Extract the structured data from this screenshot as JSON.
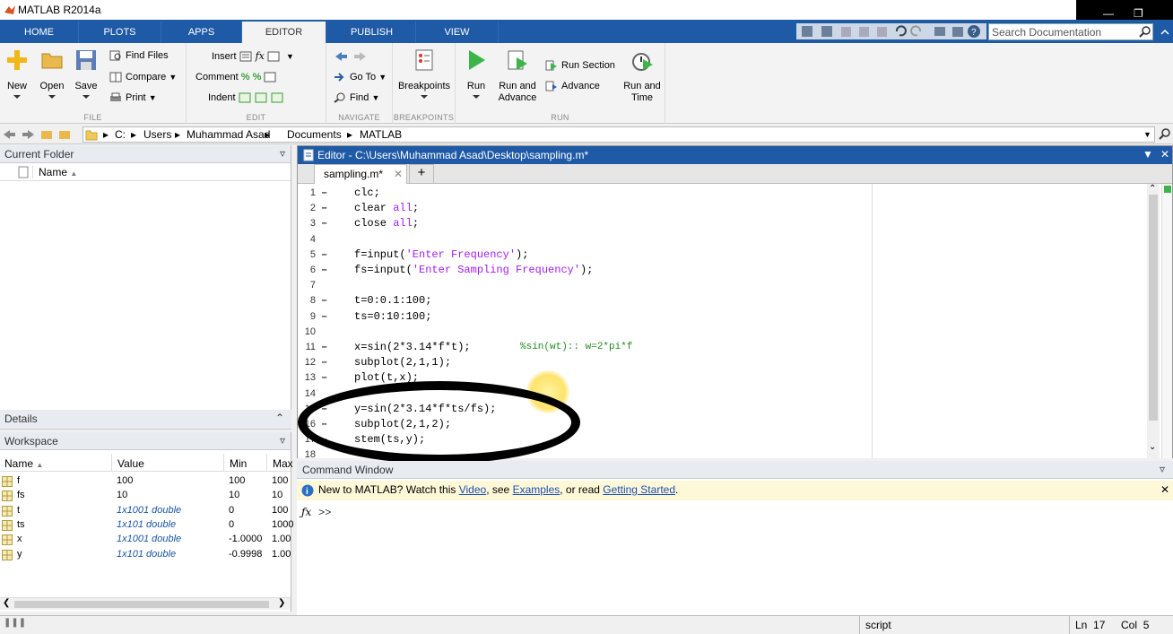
{
  "window": {
    "title": "MATLAB R2014a"
  },
  "ribbon_tabs": [
    "HOME",
    "PLOTS",
    "APPS",
    "EDITOR",
    "PUBLISH",
    "VIEW"
  ],
  "active_tab": "EDITOR",
  "search": {
    "placeholder": "Search Documentation"
  },
  "file_group": {
    "label": "FILE",
    "new": "New",
    "open": "Open",
    "save": "Save",
    "find_files": "Find Files",
    "compare": "Compare",
    "print": "Print"
  },
  "edit_group": {
    "label": "EDIT",
    "insert": "Insert",
    "comment": "Comment",
    "indent": "Indent",
    "fx": "fx"
  },
  "navigate_group": {
    "label": "NAVIGATE",
    "go_to": "Go To",
    "find": "Find"
  },
  "breakpoints_group": {
    "label": "BREAKPOINTS",
    "breakpoints": "Breakpoints"
  },
  "run_group": {
    "label": "RUN",
    "run": "Run",
    "run_and_advance": "Run and Advance",
    "run_section": "Run Section",
    "advance": "Advance",
    "run_and_time": "Run and Time"
  },
  "address": [
    "C:",
    "Users",
    "Muhammad Asad",
    "Documents",
    "MATLAB"
  ],
  "current_folder": {
    "title": "Current Folder",
    "col_name": "Name"
  },
  "details": {
    "title": "Details"
  },
  "workspace": {
    "title": "Workspace",
    "columns": [
      "Name",
      "Value",
      "Min",
      "Max"
    ],
    "rows": [
      {
        "name": "f",
        "value": "100",
        "min": "100",
        "max": "100"
      },
      {
        "name": "fs",
        "value": "10",
        "min": "10",
        "max": "10"
      },
      {
        "name": "t",
        "value": "1x1001 double",
        "min": "0",
        "max": "100"
      },
      {
        "name": "ts",
        "value": "1x101 double",
        "min": "0",
        "max": "1000"
      },
      {
        "name": "x",
        "value": "1x1001 double",
        "min": "-1.0000",
        "max": "1.00"
      },
      {
        "name": "y",
        "value": "1x101 double",
        "min": "-0.9998",
        "max": "1.00"
      }
    ]
  },
  "editor": {
    "title": "Editor - C:\\Users\\Muhammad Asad\\Desktop\\sampling.m*",
    "tab": "sampling.m*",
    "lines": [
      {
        "n": "1",
        "dash": true,
        "code": "clc;"
      },
      {
        "n": "2",
        "dash": true,
        "code": "clear all;"
      },
      {
        "n": "3",
        "dash": true,
        "code": "close all;"
      },
      {
        "n": "4",
        "dash": false,
        "code": ""
      },
      {
        "n": "5",
        "dash": true,
        "code": "f=input('Enter Frequency');"
      },
      {
        "n": "6",
        "dash": true,
        "code": "fs=input('Enter Sampling Frequency');"
      },
      {
        "n": "7",
        "dash": false,
        "code": ""
      },
      {
        "n": "8",
        "dash": true,
        "code": "t=0:0.1:100;"
      },
      {
        "n": "9",
        "dash": true,
        "code": "ts=0:10:100;"
      },
      {
        "n": "10",
        "dash": false,
        "code": ""
      },
      {
        "n": "11",
        "dash": true,
        "code": "x=sin(2*3.14*f*t);",
        "comment": "%sin(wt):: w=2*pi*f"
      },
      {
        "n": "12",
        "dash": true,
        "code": "subplot(2,1,1);"
      },
      {
        "n": "13",
        "dash": true,
        "code": "plot(t,x);"
      },
      {
        "n": "14",
        "dash": false,
        "code": ""
      },
      {
        "n": "15",
        "dash": true,
        "code": "y=sin(2*3.14*f*ts/fs);"
      },
      {
        "n": "16",
        "dash": true,
        "code": "subplot(2,1,2);"
      },
      {
        "n": "17",
        "dash": true,
        "code": "stem(ts,y);"
      },
      {
        "n": "18",
        "dash": false,
        "code": ""
      }
    ]
  },
  "command_window": {
    "title": "Command Window",
    "info_pre": "New to MATLAB? Watch this ",
    "video": "Video",
    "sep1": ", see ",
    "examples": "Examples",
    "sep2": ", or read ",
    "getting_started": "Getting Started",
    "end": ".",
    "prompt": ">>"
  },
  "status": {
    "mode": "script",
    "ln_label": "Ln",
    "ln": "17",
    "col_label": "Col",
    "col": "5"
  }
}
